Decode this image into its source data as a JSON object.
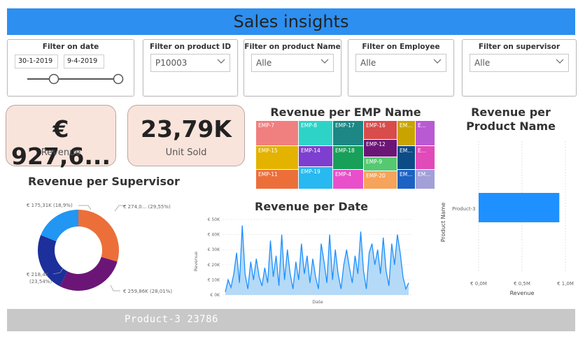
{
  "header": {
    "title": "Sales insights"
  },
  "filters": {
    "date": {
      "title": "Filter on date",
      "start": "30-1-2019",
      "end": "9-4-2019"
    },
    "product_id": {
      "title": "Filter on product ID",
      "value": "P10003"
    },
    "product_name": {
      "title": "Filter on product Name",
      "value": "Alle"
    },
    "employee": {
      "title": "Filter on Employee",
      "value": "Alle"
    },
    "supervisor": {
      "title": "Filter on supervisor",
      "value": "Alle"
    }
  },
  "cards": {
    "revenue": {
      "value": "€ 927,6...",
      "label": "Revenue"
    },
    "units": {
      "value": "23,79K",
      "label": "Unit Sold"
    }
  },
  "treemap": {
    "title": "Revenue per EMP Name",
    "tiles": [
      {
        "label": "EMP-7",
        "color": "#f07f7f"
      },
      {
        "label": "EMP-8",
        "color": "#2ed3c7"
      },
      {
        "label": "EMP-17",
        "color": "#1c8785"
      },
      {
        "label": "EMP-16",
        "color": "#d84c4c"
      },
      {
        "label": "EM...",
        "color": "#c9a400"
      },
      {
        "label": "E...",
        "color": "#b95ad2"
      },
      {
        "label": "EMP-15",
        "color": "#e3b300"
      },
      {
        "label": "EMP-14",
        "color": "#7d3fcf"
      },
      {
        "label": "EMP-18",
        "color": "#18a05a"
      },
      {
        "label": "EMP-12",
        "color": "#6b1677"
      },
      {
        "label": "EMP-9",
        "color": "#56c970"
      },
      {
        "label": "EM...",
        "color": "#0c4b86"
      },
      {
        "label": "E...",
        "color": "#e04ab9"
      },
      {
        "label": "EMP-11",
        "color": "#ec6f3a"
      },
      {
        "label": "EMP-19",
        "color": "#27b9ef"
      },
      {
        "label": "EMP-4",
        "color": "#e94fcb"
      },
      {
        "label": "EMP-20",
        "color": "#f6a35c"
      },
      {
        "label": "EM...",
        "color": "#1b62c4"
      },
      {
        "label": "EM...",
        "color": "#a39fd8"
      }
    ]
  },
  "product_chart": {
    "title": "Revenue per Product Name",
    "ylabel": "Product Name",
    "xlabel": "Revenue",
    "category": "Product-3",
    "value_m": 0.93,
    "xmax_m": 1.0,
    "ticks": [
      "€ 0,0M",
      "€ 0,5M",
      "€ 1,0M"
    ],
    "bar_color": "#1e90ff"
  },
  "supervisor_chart": {
    "title": "Revenue per Supervisor",
    "slices": [
      {
        "label": "€ 274,0... (29,55%)",
        "pct": 29.55,
        "color": "#ec6f3a"
      },
      {
        "label": "€ 259,86K (28,01%)",
        "pct": 28.01,
        "color": "#6b1677"
      },
      {
        "label": "€ 218,4K (23,54%)",
        "pct": 23.54,
        "color": "#1c2f9b"
      },
      {
        "label": "€ 175,31K (18,9%)",
        "pct": 18.9,
        "color": "#2196f3"
      }
    ]
  },
  "date_chart": {
    "title": "Revenue per Date",
    "xlabel": "Date",
    "ylabel": "Revenue",
    "yticks": [
      "€ 0K",
      "€ 10K",
      "€ 20K",
      "€ 30K",
      "€ 40K",
      "€ 50K"
    ],
    "ymax": 50,
    "values": [
      2,
      10,
      5,
      14,
      28,
      8,
      46,
      14,
      4,
      22,
      10,
      24,
      12,
      6,
      18,
      8,
      36,
      12,
      26,
      6,
      40,
      10,
      30,
      14,
      4,
      22,
      10,
      34,
      14,
      26,
      8,
      24,
      12,
      4,
      34,
      22,
      8,
      40,
      10,
      30,
      14,
      4,
      20,
      30,
      18,
      8,
      26,
      14,
      42,
      16,
      4,
      28,
      34,
      20,
      30,
      14,
      38,
      16,
      6,
      34,
      20,
      40,
      28,
      12,
      4,
      8
    ],
    "line_color": "#1e90ff",
    "fill_color": "#a8d4f6"
  },
  "footer": {
    "text": "Product-3 23786"
  }
}
